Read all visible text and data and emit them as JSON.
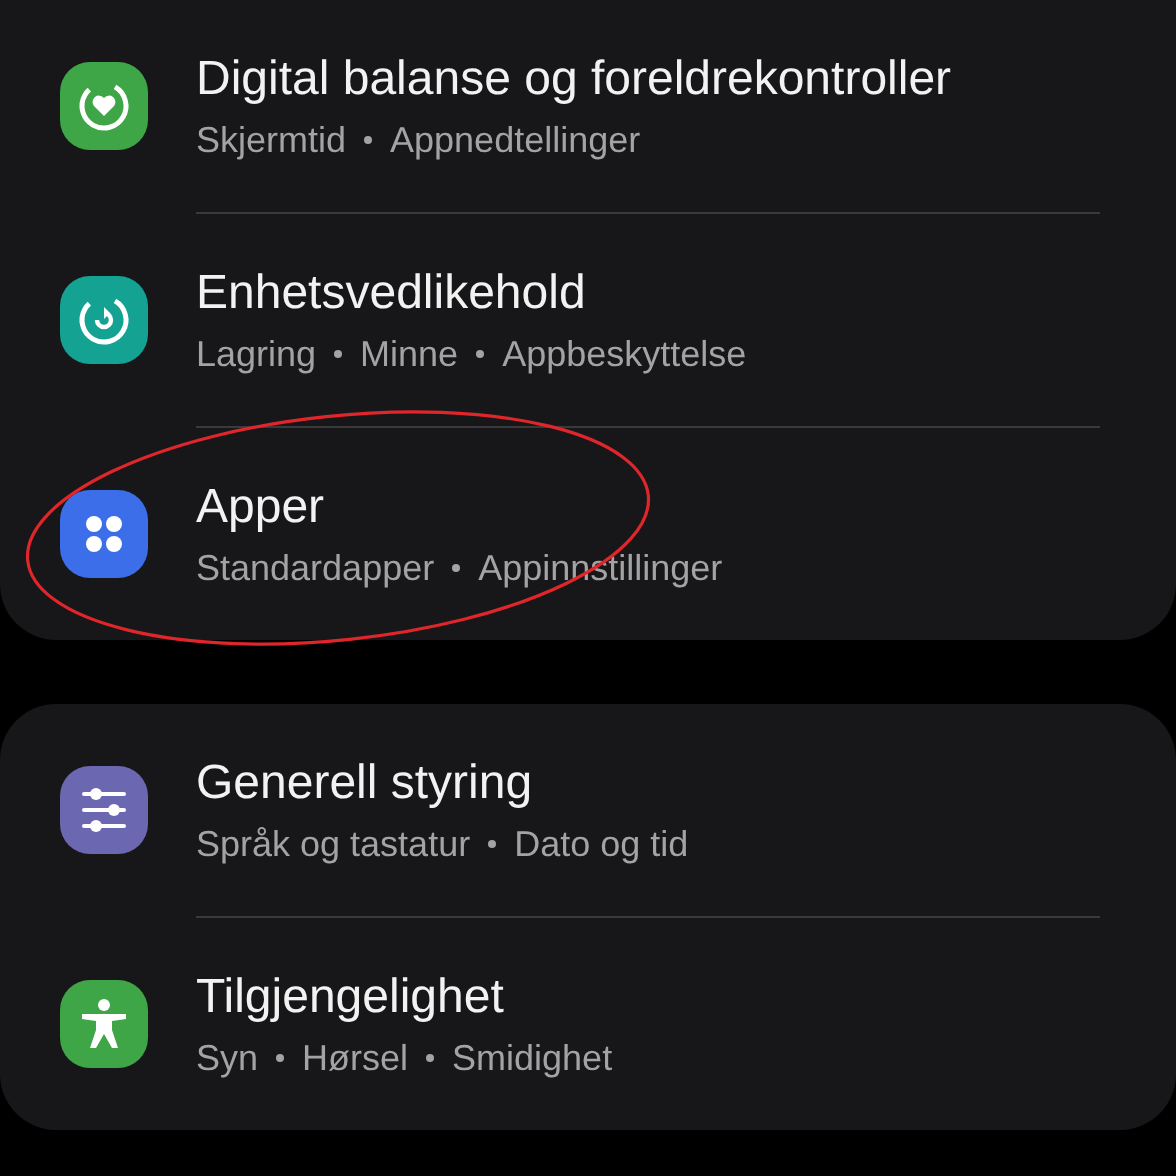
{
  "groups": [
    {
      "items": [
        {
          "kind": "heart",
          "title": "Digital balanse og foreldrekontroller",
          "subtitle": [
            "Skjermtid",
            "Appnedtellinger"
          ],
          "color": "#3fa648",
          "circled": false
        },
        {
          "kind": "refresh",
          "title": "Enhetsvedlikehold",
          "subtitle": [
            "Lagring",
            "Minne",
            "Appbeskyttelse"
          ],
          "color": "#14a392",
          "circled": false
        },
        {
          "kind": "apps",
          "title": "Apper",
          "subtitle": [
            "Standardapper",
            "Appinnstillinger"
          ],
          "color": "#3b6ee8",
          "circled": true
        }
      ]
    },
    {
      "items": [
        {
          "kind": "sliders",
          "title": "Generell styring",
          "subtitle": [
            "Språk og tastatur",
            "Dato og tid"
          ],
          "color": "#6b67b0",
          "circled": false
        },
        {
          "kind": "person",
          "title": "Tilgjengelighet",
          "subtitle": [
            "Syn",
            "Hørsel",
            "Smidighet"
          ],
          "color": "#3fa648",
          "circled": false
        }
      ]
    }
  ]
}
